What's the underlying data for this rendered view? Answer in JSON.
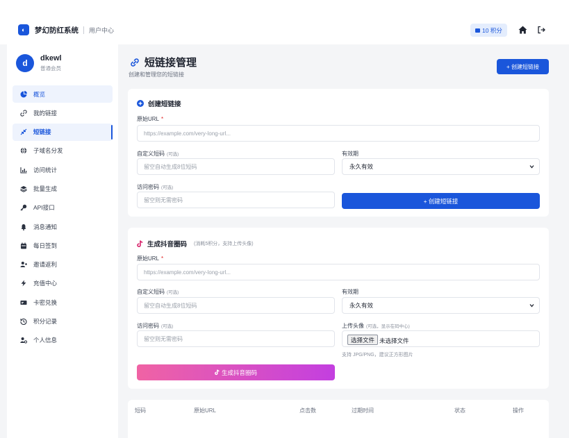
{
  "brand": {
    "logo_glyph": "◐",
    "name": "梦幻防红系统",
    "subtitle": "用户中心"
  },
  "header": {
    "points_label": "10 积分",
    "home_icon": "home-icon",
    "logout_icon": "logout-icon"
  },
  "user": {
    "avatar_letter": "d",
    "name": "dkewl",
    "role": "普通会员"
  },
  "menu": [
    {
      "label": "概览",
      "icon": "pie-chart-icon",
      "state": "light"
    },
    {
      "label": "我的链接",
      "icon": "link-icon",
      "state": ""
    },
    {
      "label": "短链接",
      "icon": "compress-icon",
      "state": "active"
    },
    {
      "label": "子域名分发",
      "icon": "globe-icon",
      "state": ""
    },
    {
      "label": "访问统计",
      "icon": "bar-chart-icon",
      "state": ""
    },
    {
      "label": "批量生成",
      "icon": "layers-icon",
      "state": ""
    },
    {
      "label": "API接口",
      "icon": "key-icon",
      "state": ""
    },
    {
      "label": "消息通知",
      "icon": "bell-icon",
      "state": ""
    },
    {
      "label": "每日签到",
      "icon": "calendar-icon",
      "state": ""
    },
    {
      "label": "邀请返利",
      "icon": "user-plus-icon",
      "state": ""
    },
    {
      "label": "充值中心",
      "icon": "bolt-icon",
      "state": ""
    },
    {
      "label": "卡密兑换",
      "icon": "ticket-icon",
      "state": ""
    },
    {
      "label": "积分记录",
      "icon": "history-icon",
      "state": ""
    },
    {
      "label": "个人信息",
      "icon": "user-cog-icon",
      "state": ""
    }
  ],
  "page": {
    "title": "短链接管理",
    "subtitle": "创建和管理您的短链接",
    "create_button": "+ 创建短链接"
  },
  "short_form": {
    "title": "创建短链接",
    "url_label": "原始URL",
    "url_required": "*",
    "url_placeholder": "https://example.com/very-long-url...",
    "code_label": "自定义短码",
    "code_optional": "(可选)",
    "code_placeholder": "留空自动生成8位短码",
    "expiry_label": "有效期",
    "expiry_value": "永久有效",
    "password_label": "访问密码",
    "password_optional": "(可选)",
    "password_placeholder": "留空则无需密码",
    "submit_label": "+ 创建短链接"
  },
  "douyin_form": {
    "title": "生成抖音圈码",
    "note": "(消耗5积分，支持上传头像)",
    "url_label": "原始URL",
    "url_required": "*",
    "url_placeholder": "https://example.com/very-long-url...",
    "code_label": "自定义短码",
    "code_optional": "(可选)",
    "code_placeholder": "留空自动生成8位短码",
    "expiry_label": "有效期",
    "expiry_value": "永久有效",
    "password_label": "访问密码",
    "password_optional": "(可选)",
    "password_placeholder": "留空则无需密码",
    "avatar_label": "上传头像",
    "avatar_optional": "(可选，显示在码中心)",
    "file_button": "选择文件",
    "file_status": "未选择文件",
    "file_hint": "支持 JPG/PNG，建议正方形图片",
    "submit_label": "生成抖音圈码"
  },
  "table": {
    "headers": [
      "短码",
      "原始URL",
      "点击数",
      "过期时间",
      "状态",
      "操作"
    ]
  },
  "colors": {
    "primary": "#1a56db",
    "pink_start": "#f063a4",
    "pink_end": "#c33fe0",
    "background": "#f4f5f7"
  }
}
